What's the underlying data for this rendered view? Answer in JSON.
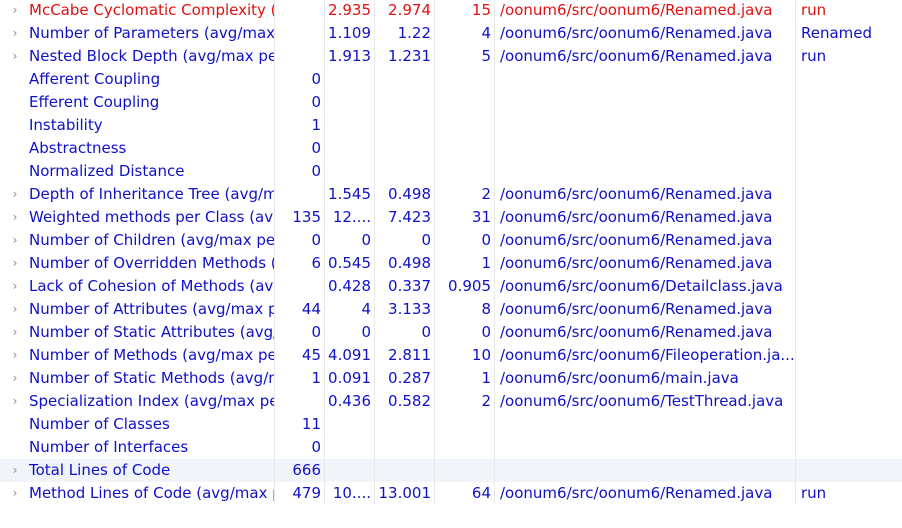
{
  "metrics": {
    "rows": [
      {
        "name": "McCabe Cyclomatic Complexity (avg/max per method)",
        "expandable": true,
        "total": "",
        "mean": "2.935",
        "std_dev": "2.974",
        "maximum": "15",
        "resource": "/oonum6/src/oonum6/Renamed.java",
        "method": "run",
        "highlight": "red"
      },
      {
        "name": "Number of Parameters (avg/max per method)",
        "expandable": true,
        "total": "",
        "mean": "1.109",
        "std_dev": "1.22",
        "maximum": "4",
        "resource": "/oonum6/src/oonum6/Renamed.java",
        "method": "Renamed"
      },
      {
        "name": "Nested Block Depth (avg/max per method)",
        "expandable": true,
        "total": "",
        "mean": "1.913",
        "std_dev": "1.231",
        "maximum": "5",
        "resource": "/oonum6/src/oonum6/Renamed.java",
        "method": "run"
      },
      {
        "name": "Afferent Coupling",
        "expandable": false,
        "total": "0",
        "mean": "",
        "std_dev": "",
        "maximum": "",
        "resource": "",
        "method": ""
      },
      {
        "name": "Efferent Coupling",
        "expandable": false,
        "total": "0",
        "mean": "",
        "std_dev": "",
        "maximum": "",
        "resource": "",
        "method": ""
      },
      {
        "name": "Instability",
        "expandable": false,
        "total": "1",
        "mean": "",
        "std_dev": "",
        "maximum": "",
        "resource": "",
        "method": ""
      },
      {
        "name": "Abstractness",
        "expandable": false,
        "total": "0",
        "mean": "",
        "std_dev": "",
        "maximum": "",
        "resource": "",
        "method": ""
      },
      {
        "name": "Normalized Distance",
        "expandable": false,
        "total": "0",
        "mean": "",
        "std_dev": "",
        "maximum": "",
        "resource": "",
        "method": ""
      },
      {
        "name": "Depth of Inheritance Tree (avg/max per type)",
        "expandable": true,
        "total": "",
        "mean": "1.545",
        "std_dev": "0.498",
        "maximum": "2",
        "resource": "/oonum6/src/oonum6/Renamed.java",
        "method": ""
      },
      {
        "name": "Weighted methods per Class (avg/max per type)",
        "expandable": true,
        "total": "135",
        "mean": "12....",
        "std_dev": "7.423",
        "maximum": "31",
        "resource": "/oonum6/src/oonum6/Renamed.java",
        "method": ""
      },
      {
        "name": "Number of Children (avg/max per type)",
        "expandable": true,
        "total": "0",
        "mean": "0",
        "std_dev": "0",
        "maximum": "0",
        "resource": "/oonum6/src/oonum6/Renamed.java",
        "method": ""
      },
      {
        "name": "Number of Overridden Methods (avg/max per type)",
        "expandable": true,
        "total": "6",
        "mean": "0.545",
        "std_dev": "0.498",
        "maximum": "1",
        "resource": "/oonum6/src/oonum6/Renamed.java",
        "method": ""
      },
      {
        "name": "Lack of Cohesion of Methods (avg/max per type)",
        "expandable": true,
        "total": "",
        "mean": "0.428",
        "std_dev": "0.337",
        "maximum": "0.905",
        "resource": "/oonum6/src/oonum6/Detailclass.java",
        "method": ""
      },
      {
        "name": "Number of Attributes (avg/max per type)",
        "expandable": true,
        "total": "44",
        "mean": "4",
        "std_dev": "3.133",
        "maximum": "8",
        "resource": "/oonum6/src/oonum6/Renamed.java",
        "method": ""
      },
      {
        "name": "Number of Static Attributes (avg/max per type)",
        "expandable": true,
        "total": "0",
        "mean": "0",
        "std_dev": "0",
        "maximum": "0",
        "resource": "/oonum6/src/oonum6/Renamed.java",
        "method": ""
      },
      {
        "name": "Number of Methods (avg/max per type)",
        "expandable": true,
        "total": "45",
        "mean": "4.091",
        "std_dev": "2.811",
        "maximum": "10",
        "resource": "/oonum6/src/oonum6/Fileoperation.ja...",
        "method": ""
      },
      {
        "name": "Number of Static Methods (avg/max per type)",
        "expandable": true,
        "total": "1",
        "mean": "0.091",
        "std_dev": "0.287",
        "maximum": "1",
        "resource": "/oonum6/src/oonum6/main.java",
        "method": ""
      },
      {
        "name": "Specialization Index (avg/max per type)",
        "expandable": true,
        "total": "",
        "mean": "0.436",
        "std_dev": "0.582",
        "maximum": "2",
        "resource": "/oonum6/src/oonum6/TestThread.java",
        "method": ""
      },
      {
        "name": "Number of Classes",
        "expandable": false,
        "total": "11",
        "mean": "",
        "std_dev": "",
        "maximum": "",
        "resource": "",
        "method": ""
      },
      {
        "name": "Number of Interfaces",
        "expandable": false,
        "total": "0",
        "mean": "",
        "std_dev": "",
        "maximum": "",
        "resource": "",
        "method": ""
      },
      {
        "name": "Total Lines of Code",
        "expandable": true,
        "total": "666",
        "mean": "",
        "std_dev": "",
        "maximum": "",
        "resource": "",
        "method": "",
        "selected": true
      },
      {
        "name": "Method Lines of Code (avg/max per method)",
        "expandable": true,
        "total": "479",
        "mean": "10....",
        "std_dev": "13.001",
        "maximum": "64",
        "resource": "/oonum6/src/oonum6/Renamed.java",
        "method": "run"
      }
    ]
  },
  "icons": {
    "expand": "chevron-right-icon",
    "expand_glyph": "›"
  },
  "colors": {
    "text": "#1010c8",
    "highlight": "#e01010",
    "selected_row": "#f1f4f8",
    "grid_line": "#e8e8e8",
    "expander": "#8a8a8a"
  }
}
